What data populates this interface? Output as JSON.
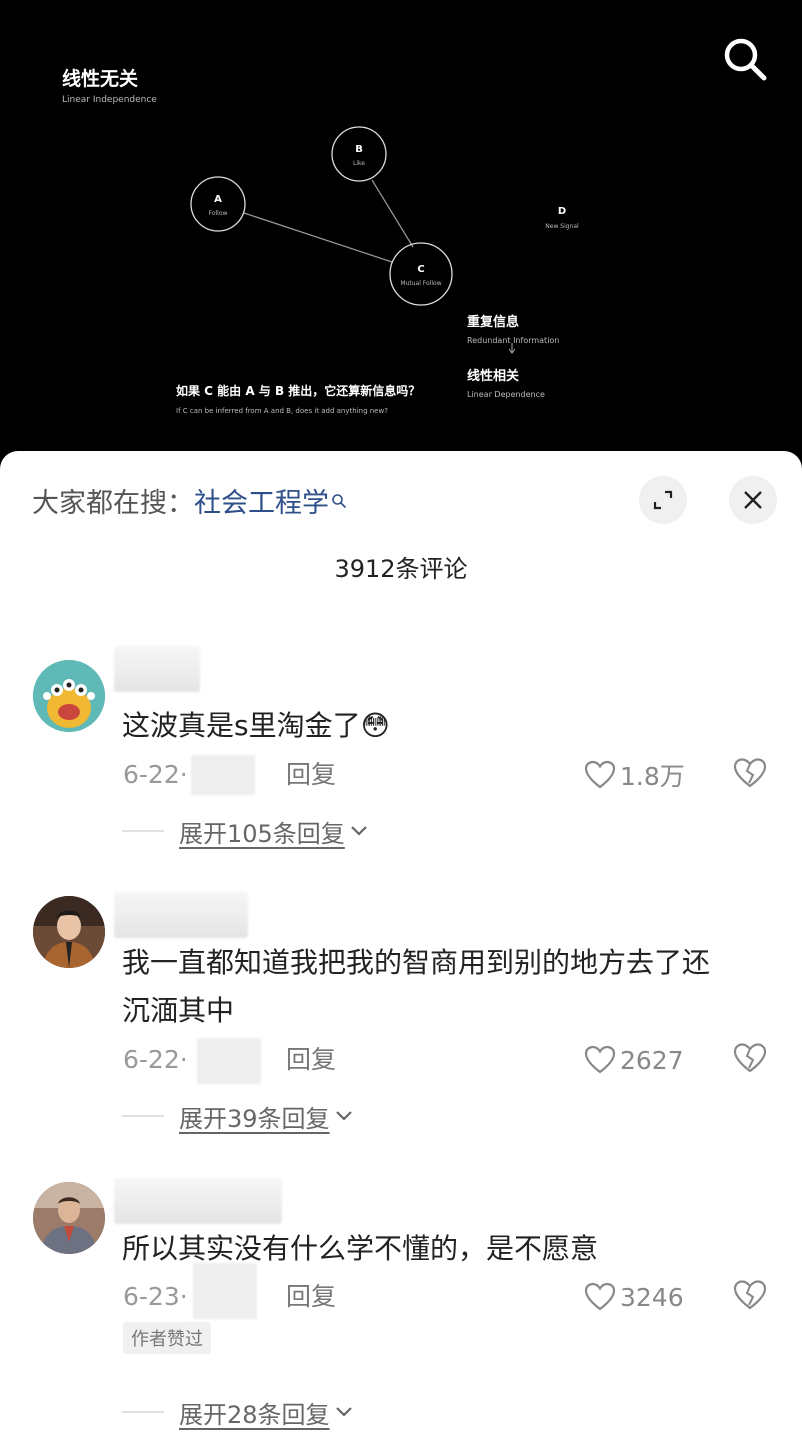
{
  "video": {
    "title_zh": "线性无关",
    "title_en": "Linear Independence",
    "nodes": [
      {
        "letter": "A",
        "label": "Follow"
      },
      {
        "letter": "B",
        "label": "Like"
      },
      {
        "letter": "C",
        "label": "Mutual Follow"
      },
      {
        "letter": "D",
        "label": "New Signal"
      }
    ],
    "redundant_zh": "重复信息",
    "redundant_en": "Redundant Information",
    "dependence_zh": "线性相关",
    "dependence_en": "Linear Dependence",
    "question_zh": "如果 C 能由 A 与 B 推出，它还算新信息吗？",
    "question_en": "If C can be inferred from A and B, does it add anything new?"
  },
  "sheet": {
    "hot_search_prefix": "大家都在搜：",
    "hot_search_term": "社会工程学",
    "comment_count": "3912条评论"
  },
  "comments": [
    {
      "text_lines": [
        "这波真是s里淘金了😳"
      ],
      "date": "6-22·",
      "reply": "回复",
      "likes": "1.8万",
      "expand": "展开105条回复"
    },
    {
      "text_lines": [
        "我一直都知道我把我的智商用到别的地方去了还",
        "沉湎其中"
      ],
      "date": "6-22·",
      "reply": "回复",
      "likes": "2627",
      "expand": "展开39条回复"
    },
    {
      "text_lines": [
        "所以其实没有什么学不懂的，是不愿意"
      ],
      "date": "6-23·",
      "reply": "回复",
      "likes": "3246",
      "badge": "作者赞过",
      "expand": "展开28条回复"
    }
  ],
  "icons": {
    "search": "search-icon",
    "expand": "expand-icon",
    "close": "close-icon",
    "like": "heart-icon",
    "dislike": "broken-heart-icon",
    "chevron": "chevron-down-icon"
  }
}
